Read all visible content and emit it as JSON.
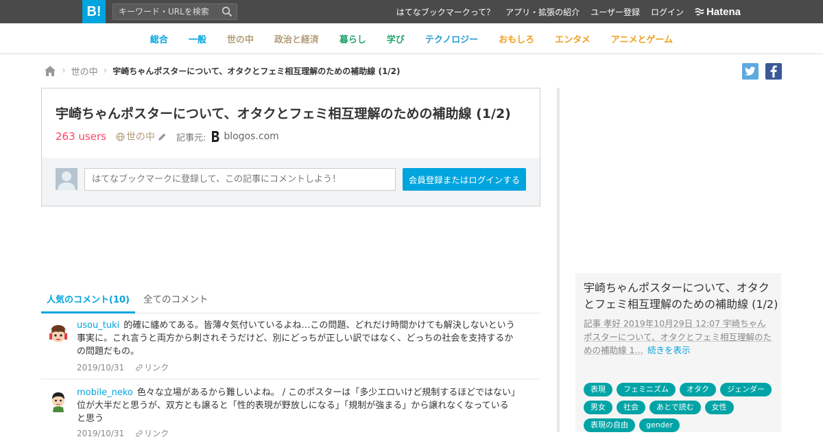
{
  "header": {
    "logo_label": "B!",
    "search_placeholder": "キーワード・URLを検索",
    "nav": [
      "はてなブックマークって？",
      "アプリ・拡張の紹介",
      "ユーザー登録",
      "ログイン"
    ],
    "brand": "Hatena"
  },
  "categories": [
    {
      "label": "総合",
      "color": "#00a4de"
    },
    {
      "label": "一般",
      "color": "#00a4de"
    },
    {
      "label": "世の中",
      "color": "#b39b77"
    },
    {
      "label": "政治と経済",
      "color": "#b39b77"
    },
    {
      "label": "暮らし",
      "color": "#23a66d"
    },
    {
      "label": "学び",
      "color": "#23a66d"
    },
    {
      "label": "テクノロジー",
      "color": "#2a9bd0"
    },
    {
      "label": "おもしろ",
      "color": "#f0a020"
    },
    {
      "label": "エンタメ",
      "color": "#f0a020"
    },
    {
      "label": "アニメとゲーム",
      "color": "#f0a020"
    }
  ],
  "breadcrumb": {
    "category": "世の中",
    "current": "宇崎ちゃんポスターについて、オタクとフェミ相互理解のための補助線 (1/2)"
  },
  "social": {
    "twitter_color": "#5ea9dd",
    "facebook_color": "#3b5998"
  },
  "entry": {
    "title": "宇崎ちゃんポスターについて、オタクとフェミ相互理解のための補助線 (1/2)",
    "users": "263 users",
    "category": "世の中",
    "source_label": "記事元:",
    "source": "blogos.com",
    "comment_placeholder": "はてなブックマークに登録して、この記事にコメントしよう！",
    "login_button": "会員登録またはログインする"
  },
  "tabs": {
    "popular": "人気のコメント(10)",
    "all": "全てのコメント"
  },
  "comments": [
    {
      "user": "usou_tuki",
      "text": "的確に纏めてある。皆薄々気付いているよね…この問題、どれだけ時間かけても解決しないという事実に。これ言うと両方から刺されそうだけど、別にどっちが正しい訳ではなく、どっちの社会を支持するかの問題だもの。",
      "date": "2019/10/31",
      "link": "リンク"
    },
    {
      "user": "mobile_neko",
      "text": "色々な立場があるから難しいよね。 / このポスターは「多少エロいけど規制するほどではない」位が大半だと思うが、双方とも譲ると「性的表現が野放しになる」「規制が強まる」から譲れなくなっていると思う",
      "date": "2019/10/31",
      "link": "リンク"
    }
  ],
  "side": {
    "title": "宇崎ちゃんポスターについて、オタクとフェミ相互理解のための補助線 (1/2)",
    "desc_prefix": "記事 孝好 2019年10月29日 12:07 宇崎ちゃんポスターについて、オタクとフェミ相互理解のための補助線 1…",
    "more": "続きを表示",
    "tags": [
      "表現",
      "フェミニズム",
      "オタク",
      "ジェンダー",
      "男女",
      "社会",
      "あとで読む",
      "女性",
      "表現の自由",
      "gender"
    ]
  }
}
